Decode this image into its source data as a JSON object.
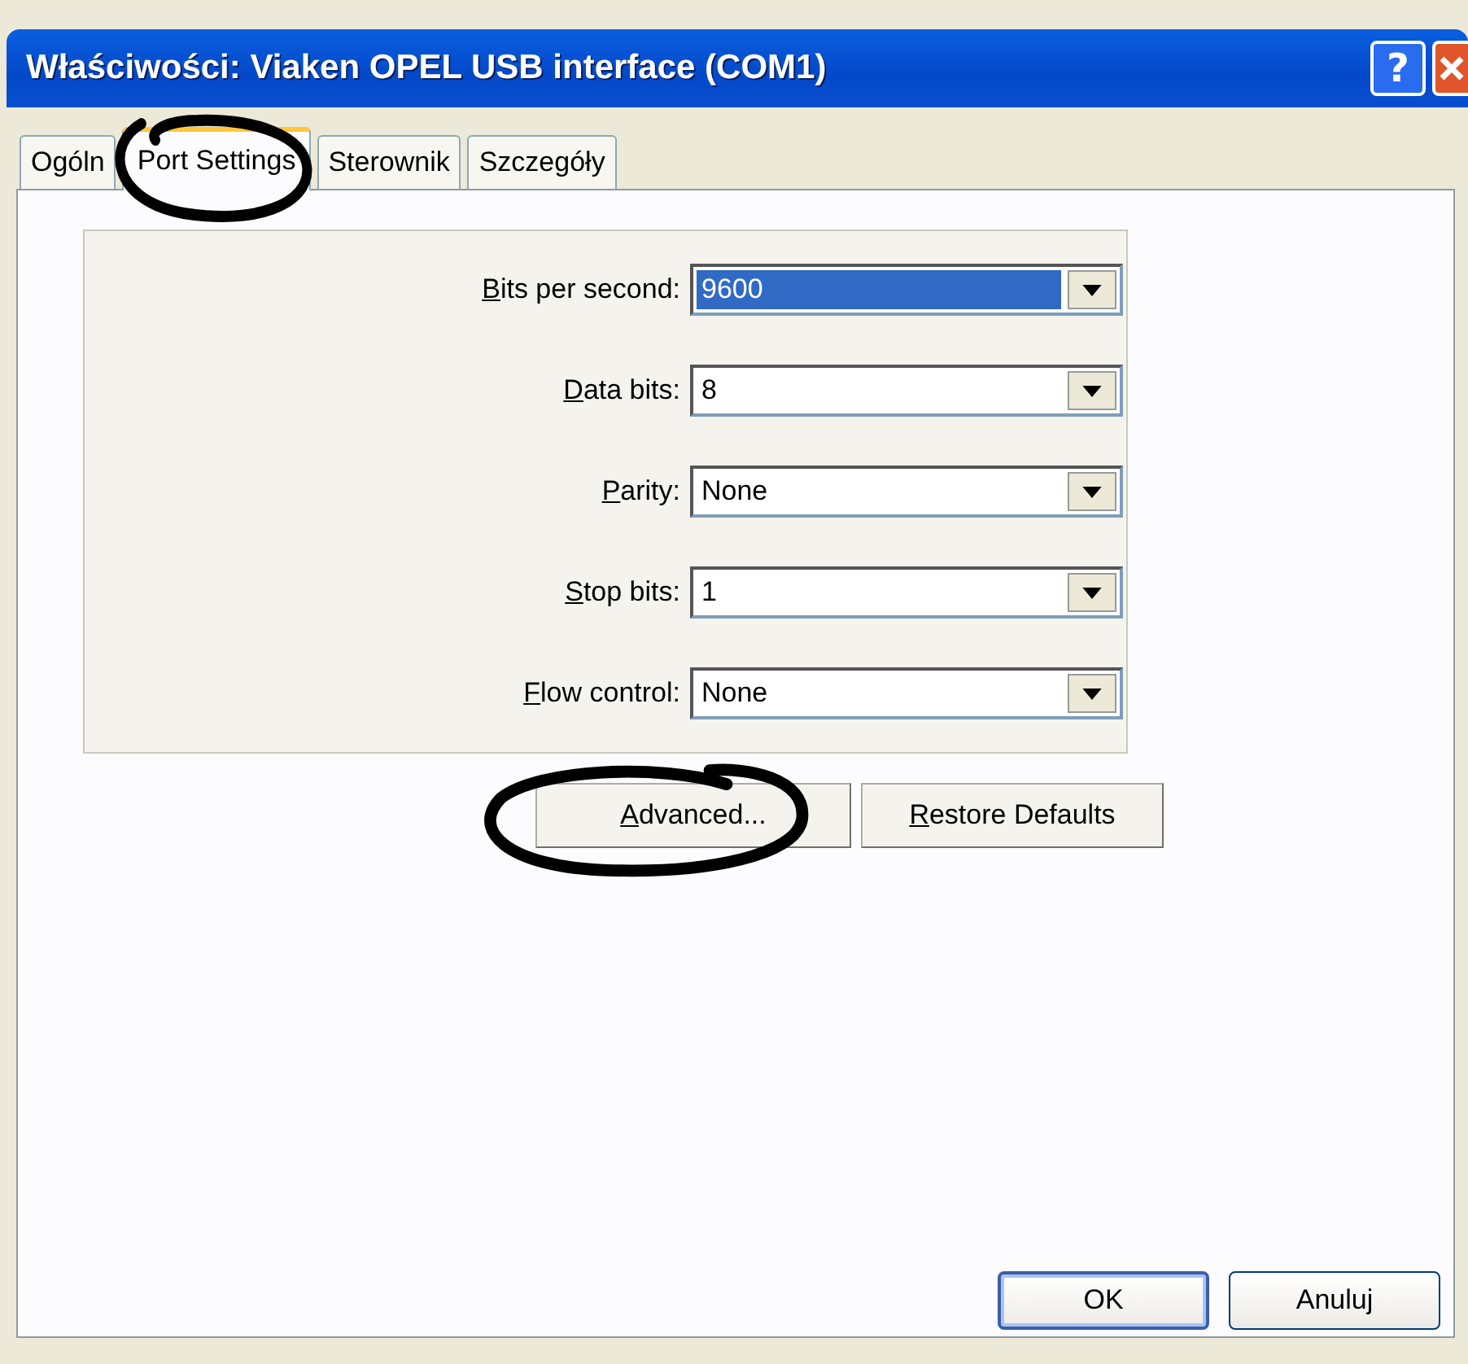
{
  "window": {
    "title": "Właściwości: Viaken OPEL USB interface (COM1)"
  },
  "title_buttons": [
    {
      "kind": "help",
      "label": "?"
    },
    {
      "kind": "close"
    }
  ],
  "tabs": [
    {
      "label": "Ogóln",
      "selected": false,
      "circled": false
    },
    {
      "label": "Port Settings",
      "selected": true,
      "circled": true
    },
    {
      "label": "Sterownik",
      "selected": false,
      "circled": false
    },
    {
      "label": "Szczegóły",
      "selected": false,
      "circled": false
    }
  ],
  "settings": [
    {
      "label": "Bits per second:",
      "value": "9600",
      "highlighted": true
    },
    {
      "label": "Data bits:",
      "value": "8",
      "highlighted": false
    },
    {
      "label": "Parity:",
      "value": "None",
      "highlighted": false
    },
    {
      "label": "Stop bits:",
      "value": "1",
      "highlighted": false
    },
    {
      "label": "Flow control:",
      "value": "None",
      "highlighted": false
    }
  ],
  "page_buttons": [
    {
      "label": "Advanced...",
      "circled": true
    },
    {
      "label": "Restore Defaults",
      "circled": false
    }
  ],
  "dialog_buttons": [
    {
      "label": "OK",
      "default": true
    },
    {
      "label": "Anuluj",
      "default": false
    }
  ]
}
